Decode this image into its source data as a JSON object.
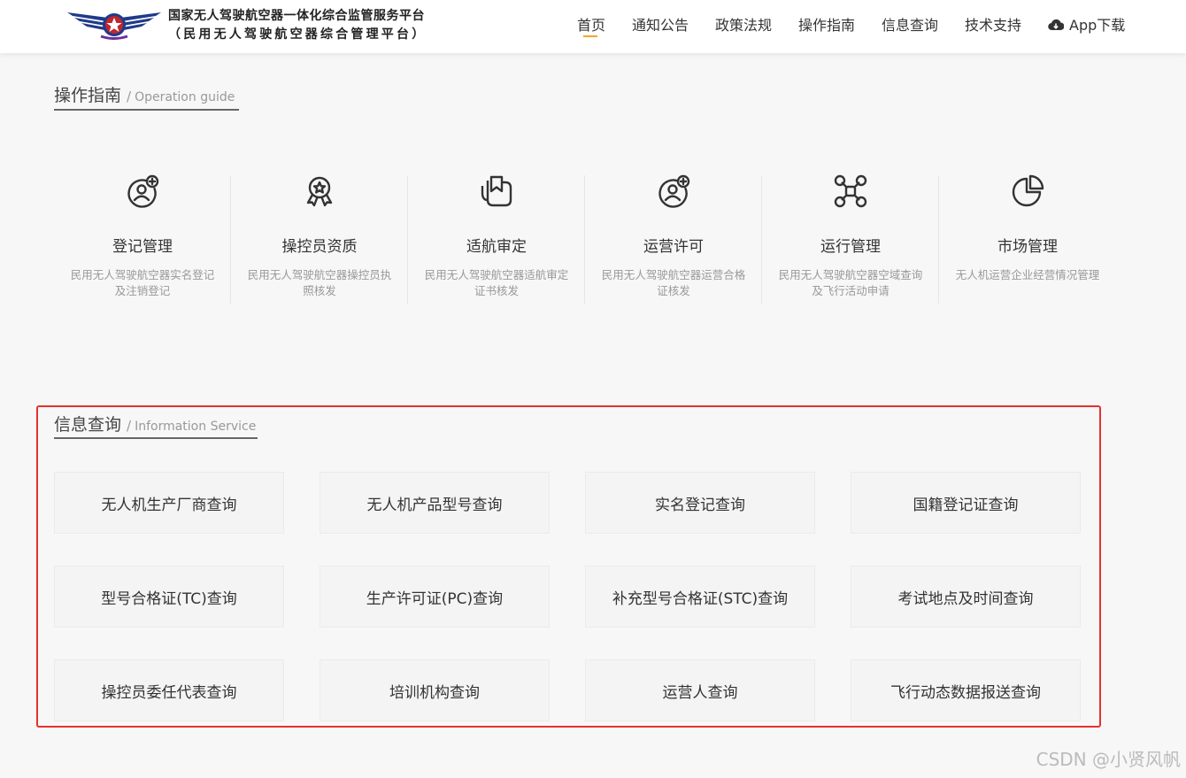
{
  "header": {
    "brand_line1": "国家无人驾驶航空器一体化综合监管服务平台",
    "brand_line2": "（民用无人驾驶航空器综合管理平台）",
    "nav": [
      {
        "label": "首页",
        "active": true
      },
      {
        "label": "通知公告"
      },
      {
        "label": "政策法规"
      },
      {
        "label": "操作指南"
      },
      {
        "label": "信息查询"
      },
      {
        "label": "技术支持"
      },
      {
        "label": "App下载",
        "icon": "cloud-download-icon"
      }
    ],
    "accent_color": "#f5a623"
  },
  "guide_section": {
    "title": "操作指南",
    "separator": "/",
    "subtitle": "Operation guide",
    "items": [
      {
        "title": "登记管理",
        "desc": "民用无人驾驶航空器实名登记及注销登记",
        "icon": "user-add-icon"
      },
      {
        "title": "操控员资质",
        "desc": "民用无人驾驶航空器操控员执照核发",
        "icon": "award-badge-icon"
      },
      {
        "title": "适航审定",
        "desc": "民用无人驾驶航空器适航审定证书核发",
        "icon": "certificate-icon"
      },
      {
        "title": "运营许可",
        "desc": "民用无人驾驶航空器运营合格证核发",
        "icon": "user-add-icon"
      },
      {
        "title": "运行管理",
        "desc": "民用无人驾驶航空器空域查询及飞行活动申请",
        "icon": "drone-icon"
      },
      {
        "title": "市场管理",
        "desc": "无人机运营企业经营情况管理",
        "icon": "pie-chart-icon"
      }
    ]
  },
  "info_section": {
    "title": "信息查询",
    "separator": "/",
    "subtitle": "Information Service",
    "buttons": [
      "无人机生产厂商查询",
      "无人机产品型号查询",
      "实名登记查询",
      "国籍登记证查询",
      "型号合格证(TC)查询",
      "生产许可证(PC)查询",
      "补充型号合格证(STC)查询",
      "考试地点及时间查询",
      "操控员委任代表查询",
      "培训机构查询",
      "运营人查询",
      "飞行动态数据报送查询"
    ],
    "highlight_color": "#e5322d"
  },
  "watermark": "CSDN @小贤风帆"
}
